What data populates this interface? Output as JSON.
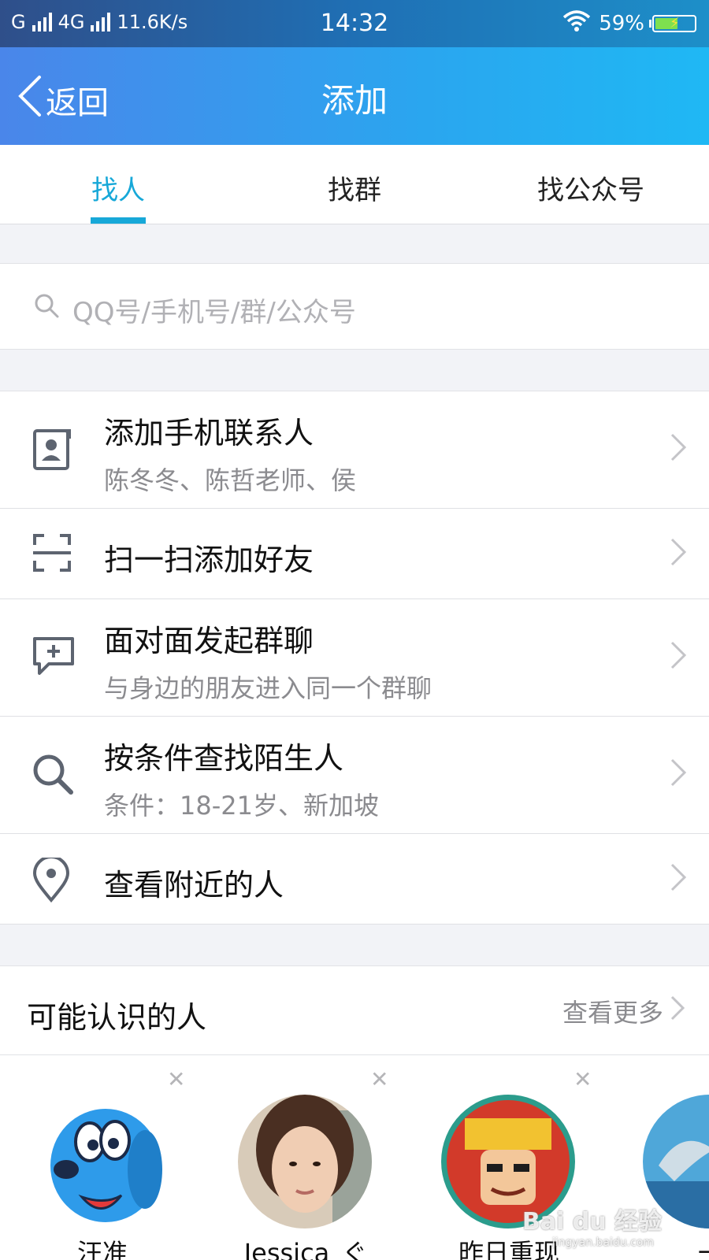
{
  "status_bar": {
    "carrier1": "G",
    "carrier2": "4G",
    "speed": "11.6K/s",
    "time": "14:32",
    "battery_percent": "59%",
    "battery_level": 0.59,
    "accent": "#7ee04f"
  },
  "nav": {
    "back_label": "返回",
    "title": "添加"
  },
  "tabs": [
    {
      "label": "找人",
      "active": true
    },
    {
      "label": "找群",
      "active": false
    },
    {
      "label": "找公众号",
      "active": false
    }
  ],
  "search": {
    "placeholder": "QQ号/手机号/群/公众号",
    "icon": "search-icon"
  },
  "menu": [
    {
      "icon": "contact-card-icon",
      "title": "添加手机联系人",
      "subtitle": "陈冬冬、陈哲老师、侯"
    },
    {
      "icon": "scan-icon",
      "title": "扫一扫添加好友"
    },
    {
      "icon": "chat-add-icon",
      "title": "面对面发起群聊",
      "subtitle": "与身边的朋友进入同一个群聊"
    },
    {
      "icon": "search-icon",
      "title": "按条件查找陌生人",
      "subtitle": "条件：18-21岁、新加坡"
    },
    {
      "icon": "location-pin-icon",
      "title": "查看附近的人"
    }
  ],
  "may_know": {
    "title": "可能认识的人",
    "more_label": "查看更多",
    "people": [
      {
        "name": "汪准",
        "avatar": "blue-dog-avatar"
      },
      {
        "name": "Jessica_ぐ",
        "avatar": "woman-photo-avatar"
      },
      {
        "name": "昨日重现",
        "avatar": "cartoon-monkey-avatar"
      },
      {
        "name": "一",
        "avatar": "dolphin-avatar"
      }
    ]
  },
  "watermark": {
    "brand": "Bai du 经验",
    "url": "jingyan.baidu.com"
  },
  "colors": {
    "accent": "#17a8d8",
    "nav_gradient_start": "#4a86ea",
    "nav_gradient_end": "#1fb8f4",
    "icon_gray": "#5d6470"
  }
}
